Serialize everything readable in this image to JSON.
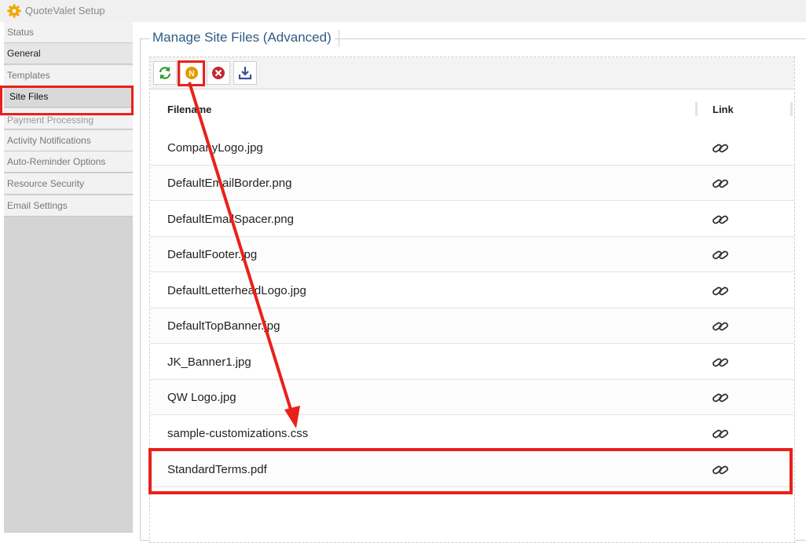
{
  "app": {
    "title": "QuoteValet Setup",
    "icon": "gear-icon"
  },
  "sidebar": {
    "items": [
      {
        "label": "Status"
      },
      {
        "label": "General"
      },
      {
        "label": "Templates"
      },
      {
        "label": "Site Files"
      },
      {
        "label": "Payment Processing"
      },
      {
        "label": "Activity Notifications"
      },
      {
        "label": "Auto-Reminder Options"
      },
      {
        "label": "Resource Security"
      },
      {
        "label": "Email Settings"
      }
    ],
    "active": "Site Files"
  },
  "main": {
    "legend": "Manage Site Files (Advanced)",
    "toolbar": {
      "buttons": [
        {
          "icon": "refresh-icon"
        },
        {
          "icon": "new-icon",
          "glyph": "N"
        },
        {
          "icon": "delete-icon"
        },
        {
          "icon": "download-icon"
        }
      ]
    },
    "grid": {
      "columns": [
        "Filename",
        "Link"
      ],
      "rows": [
        {
          "filename": "CompanyLogo.jpg"
        },
        {
          "filename": "DefaultEmailBorder.png"
        },
        {
          "filename": "DefaultEmailSpacer.png"
        },
        {
          "filename": "DefaultFooter.jpg"
        },
        {
          "filename": "DefaultLetterheadLogo.jpg"
        },
        {
          "filename": "DefaultTopBanner.jpg"
        },
        {
          "filename": "JK_Banner1.jpg"
        },
        {
          "filename": "QW Logo.jpg"
        },
        {
          "filename": "sample-customizations.css"
        },
        {
          "filename": "StandardTerms.pdf"
        }
      ]
    }
  },
  "colors": {
    "highlight": "#e8211b",
    "legend": "#2f5b85",
    "accent": "#f0a500"
  }
}
